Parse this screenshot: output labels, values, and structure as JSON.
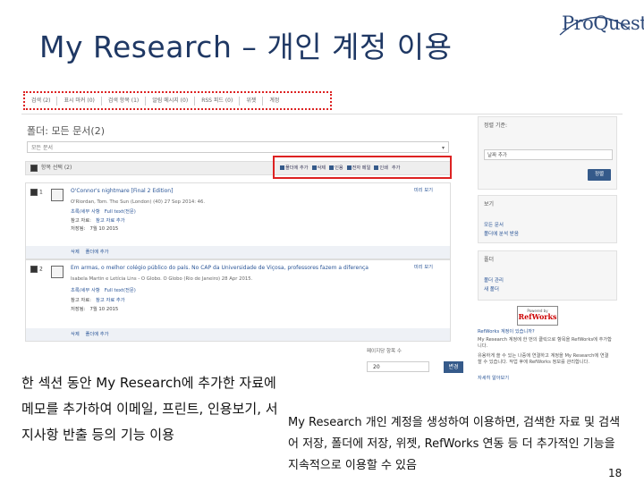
{
  "slide": {
    "title": "My Research – 개인 계정 이용",
    "page_number": "18"
  },
  "logo": {
    "text": "ProQuest"
  },
  "screenshot": {
    "tabs": [
      "검색 (2)",
      "표시 마커 (0)",
      "검색 항목 (1)",
      "알림 메시지 (0)",
      "RSS 피드 (0)",
      "위젯",
      "계정"
    ],
    "folder_title": "폴더: 모든 문서(2)",
    "folder_select": "모든 문서",
    "select_all": "항목 선택 (2)",
    "actions": [
      "폴더에 추가",
      "삭제",
      "인용",
      "전자 메일",
      "인쇄",
      "추가"
    ],
    "records": [
      {
        "num": "1",
        "title": "O'Connor's nightmare [Final 2 Edition]",
        "author": "O'Riordan, Tom. The Sun (London) (40) 27 Sep 2014: 46.",
        "abstract_label": "초록/세부 사항",
        "fulltext": "Full text(전문)",
        "refs_label": "참고 자료:",
        "refs_link": "참고 자료 추가",
        "saved_label": "저장됨:",
        "saved_date": "7월 10 2015",
        "preview": "미리 보기",
        "foot_delete": "삭제",
        "foot_folder": "폴더에 추가"
      },
      {
        "num": "2",
        "title": "Em armas, o melhor colégio público do país. No CAP da Universidade de Viçosa, professores fazem a diferença",
        "author": "Isabela Martin e Letícia Lins - O Globo. O Globo (Rio de Janeiro) 28 Apr 2015.",
        "abstract_label": "초록/세부 사항",
        "fulltext": "Full text(전문)",
        "refs_label": "참고 자료:",
        "refs_link": "참고 자료 추가",
        "saved_label": "저장됨:",
        "saved_date": "7월 10 2015",
        "preview": "미리 보기",
        "foot_delete": "삭제",
        "foot_folder": "폴더에 추가"
      }
    ],
    "sidebar": {
      "sort_header": "정렬 기준:",
      "sort_value": "날짜 추가",
      "sort_button": "정렬",
      "view_header": "보기",
      "view_items": [
        "모든 문서",
        "폴더에 분석 받음"
      ],
      "folder_header": "폴더",
      "folder_items": [
        "폴더 관리",
        "새 폴더"
      ],
      "rw_powered": "Powered by",
      "rw_logo": "RefWorks",
      "rw_q": "RefWorks 계정이 있습니까?",
      "rw_text": "My Research 계정에 한 번의 클릭으로 항목을 RefWorks에 추가합니다.",
      "rw_text2": "유용하게 쓸 수 있는 나중에 연결하고 계정을 My Research에 연결할 수 있습니다. 작업 후에 RefWorks 정보를 관리합니다.",
      "rw_more": "자세히 알아보기"
    },
    "per_page_label": "페이지당 항목 수",
    "per_page_value": "20",
    "per_page_button": "변경"
  },
  "captions": {
    "left": "한 섹션 동안 My Research에 추가한 자료에 메모를 추가하여 이메일, 프린트, 인용보기, 서지사항 반출 등의 기능 이용",
    "right": "My Research 개인 계정을 생성하여 이용하면, 검색한 자료 및 검색어 저장, 폴더에 저장, 위젯, RefWorks 연동 등 더 추가적인 기능을 지속적으로 이용할 수 있음"
  }
}
